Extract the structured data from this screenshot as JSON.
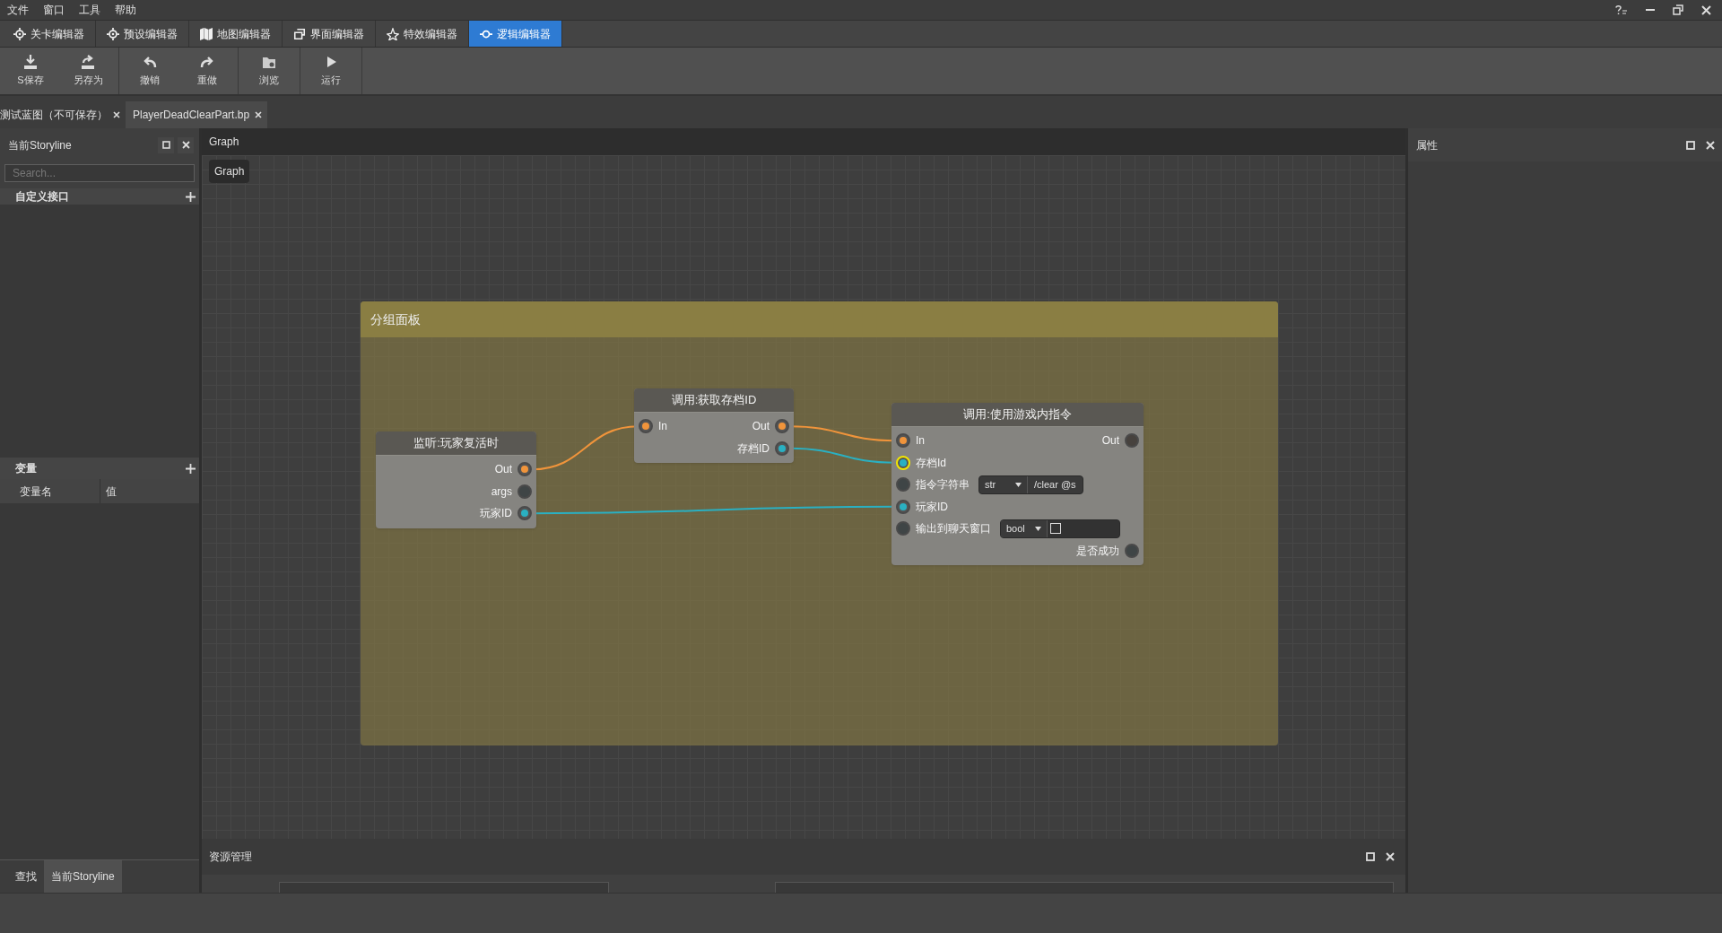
{
  "menu": [
    "文件",
    "窗口",
    "工具",
    "帮助"
  ],
  "editor_tabs": [
    {
      "label": "关卡编辑器",
      "selected": false
    },
    {
      "label": "预设编辑器",
      "selected": false
    },
    {
      "label": "地图编辑器",
      "selected": false
    },
    {
      "label": "界面编辑器",
      "selected": false
    },
    {
      "label": "特效编辑器",
      "selected": false
    },
    {
      "label": "逻辑编辑器",
      "selected": true
    }
  ],
  "toolbar": [
    [
      {
        "label": "S保存"
      },
      {
        "label": "另存为"
      }
    ],
    [
      {
        "label": "撤销"
      },
      {
        "label": "重做"
      }
    ],
    [
      {
        "label": "浏览"
      }
    ],
    [
      {
        "label": "运行"
      }
    ]
  ],
  "documents": [
    {
      "label": "测试蓝图（不可保存）",
      "selected": false
    },
    {
      "label": "PlayerDeadClearPart.bp",
      "selected": true
    }
  ],
  "left_panel": {
    "title": "当前Storyline",
    "search_placeholder": "Search...",
    "interfaces": {
      "title": "自定义接口"
    },
    "variables": {
      "title": "变量",
      "columns": [
        "变量名",
        "值"
      ]
    },
    "bottom_tabs": [
      {
        "label": "查找",
        "selected": false
      },
      {
        "label": "当前Storyline",
        "selected": true
      }
    ]
  },
  "graph": {
    "tab": "Graph",
    "breadcrumb": "Graph",
    "group": {
      "title": "分组面板"
    },
    "nodes": [
      {
        "title": "监听:玩家复活时",
        "rows": [
          {
            "right": {
              "label": "Out",
              "kind": "exec",
              "connected": true
            }
          },
          {
            "right": {
              "label": "args",
              "kind": "data",
              "connected": false
            }
          },
          {
            "right": {
              "label": "玩家ID",
              "kind": "data",
              "connected": true
            }
          }
        ]
      },
      {
        "title": "调用:获取存档ID",
        "rows": [
          {
            "left": {
              "label": "In",
              "kind": "exec",
              "connected": true
            },
            "right": {
              "label": "Out",
              "kind": "exec",
              "connected": true
            }
          },
          {
            "right": {
              "label": "存档ID",
              "kind": "data",
              "connected": true
            }
          }
        ]
      },
      {
        "title": "调用:使用游戏内指令",
        "rows": [
          {
            "left": {
              "label": "In",
              "kind": "exec",
              "connected": true
            },
            "right": {
              "label": "Out",
              "kind": "exec",
              "connected": false
            }
          },
          {
            "left": {
              "label": "存档Id",
              "kind": "data",
              "connected": true,
              "highlighted": true
            }
          },
          {
            "left": {
              "label": "指令字符串",
              "kind": "data",
              "connected": false
            },
            "field": {
              "kind": "text",
              "type": "str",
              "value": "/clear @s"
            }
          },
          {
            "left": {
              "label": "玩家ID",
              "kind": "data",
              "connected": true
            }
          },
          {
            "left": {
              "label": "输出到聊天窗口",
              "kind": "data",
              "connected": false
            },
            "field": {
              "kind": "check",
              "type": "bool",
              "checked": false
            }
          },
          {
            "right": {
              "label": "是否成功",
              "kind": "data",
              "connected": false
            }
          }
        ]
      }
    ]
  },
  "properties": {
    "title": "属性"
  },
  "assets": {
    "title": "资源管理"
  }
}
